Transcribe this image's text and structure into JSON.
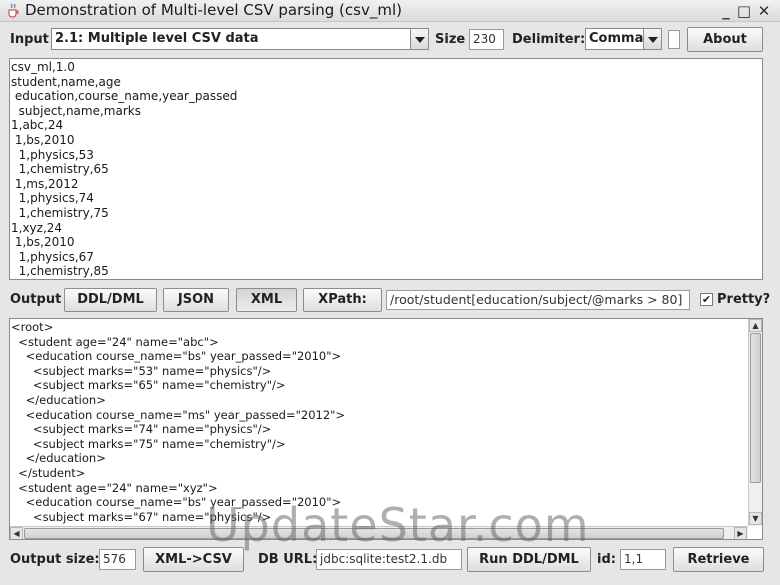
{
  "window": {
    "title": "Demonstration of Multi-level CSV parsing (csv_ml)",
    "controls": {
      "minimize": "_",
      "maximize": "□",
      "close": "✕"
    }
  },
  "top": {
    "input_label": "Input",
    "input_select": "2.1: Multiple level CSV data",
    "size_label": "Size",
    "size_value": "230",
    "delimiter_label": "Delimiter:",
    "delimiter_select": "Comma",
    "about_label": "About"
  },
  "input_text": "csv_ml,1.0\nstudent,name,age\n education,course_name,year_passed\n  subject,name,marks\n1,abc,24\n 1,bs,2010\n  1,physics,53\n  1,chemistry,65\n 1,ms,2012\n  1,physics,74\n  1,chemistry,75\n1,xyz,24\n 1,bs,2010\n  1,physics,67\n  1,chemistry,85",
  "output_bar": {
    "label": "Output",
    "ddl_label": "DDL/DML",
    "json_label": "JSON",
    "xml_label": "XML",
    "xpath_label": "XPath:",
    "xpath_value": "/root/student[education/subject/@marks > 80]",
    "pretty_label": "Pretty?",
    "pretty_checked": "✔"
  },
  "output_text": "<root>\n  <student age=\"24\" name=\"abc\">\n    <education course_name=\"bs\" year_passed=\"2010\">\n      <subject marks=\"53\" name=\"physics\"/>\n      <subject marks=\"65\" name=\"chemistry\"/>\n    </education>\n    <education course_name=\"ms\" year_passed=\"2012\">\n      <subject marks=\"74\" name=\"physics\"/>\n      <subject marks=\"75\" name=\"chemistry\"/>\n    </education>\n  </student>\n  <student age=\"24\" name=\"xyz\">\n    <education course_name=\"bs\" year_passed=\"2010\">\n      <subject marks=\"67\" name=\"physics\"/>",
  "bottom": {
    "output_size_label": "Output size:",
    "output_size_value": "576",
    "xml_csv_label": "XML->CSV",
    "db_url_label": "DB URL:",
    "db_url_value": "jdbc:sqlite:test2.1.db",
    "run_label": "Run DDL/DML",
    "id_label": "id:",
    "id_value": "1,1",
    "retrieve_label": "Retrieve"
  },
  "watermark": "UpdateStar.com",
  "icons": [
    "java-cup-icon",
    "minimize-icon",
    "maximize-icon",
    "close-icon",
    "dropdown-arrow-icon",
    "checkmark-icon",
    "scroll-up-icon",
    "scroll-down-icon",
    "scroll-left-icon",
    "scroll-right-icon"
  ]
}
